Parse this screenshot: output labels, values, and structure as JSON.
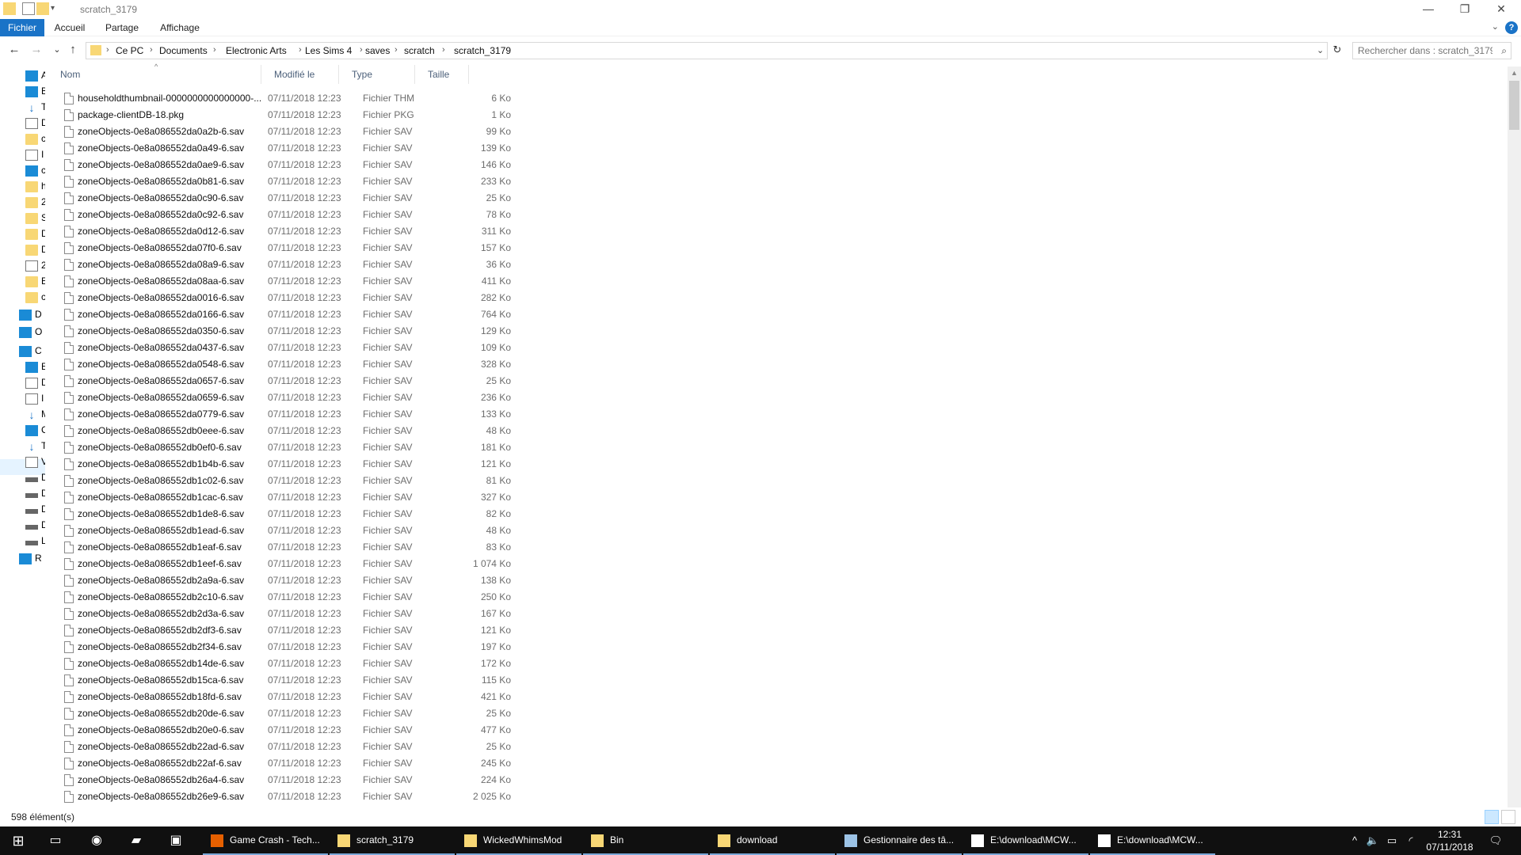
{
  "window": {
    "title": "scratch_3179",
    "minimize": "—",
    "maximize": "❐",
    "close": "✕"
  },
  "ribbon": {
    "tabs": [
      "Fichier",
      "Accueil",
      "Partage",
      "Affichage"
    ],
    "help": "?",
    "chevron": "⌄"
  },
  "nav": {
    "back": "←",
    "forward": "→",
    "recent": "⌄",
    "up": "↑",
    "refresh": "↻",
    "history": "⌄",
    "breadcrumb": [
      "Ce PC",
      "Documents",
      "Electronic Arts",
      "Les Sims 4",
      "saves",
      "scratch",
      "scratch_3179"
    ],
    "separator": "›"
  },
  "search": {
    "placeholder": "Rechercher dans : scratch_3179"
  },
  "sidebar": {
    "items": [
      "Ac",
      "B",
      "T",
      "D",
      "c",
      "I",
      "c",
      "h",
      "2",
      "S",
      "D",
      "D",
      "2",
      "E",
      "c",
      "Dr",
      "Or",
      "Ce",
      "E",
      "D",
      "I",
      "M",
      "C",
      "T",
      "V",
      "D",
      "D",
      "D",
      "D",
      "L",
      "Ré"
    ]
  },
  "columns": {
    "name": "Nom",
    "modified": "Modifié le",
    "type": "Type",
    "size": "Taille",
    "sort": "^"
  },
  "files": [
    {
      "name": "householdthumbnail-0000000000000000-...",
      "date": "07/11/2018 12:23",
      "type": "Fichier THM",
      "size": "6 Ko"
    },
    {
      "name": "package-clientDB-18.pkg",
      "date": "07/11/2018 12:23",
      "type": "Fichier PKG",
      "size": "1 Ko"
    },
    {
      "name": "zoneObjects-0e8a086552da0a2b-6.sav",
      "date": "07/11/2018 12:23",
      "type": "Fichier SAV",
      "size": "99 Ko"
    },
    {
      "name": "zoneObjects-0e8a086552da0a49-6.sav",
      "date": "07/11/2018 12:23",
      "type": "Fichier SAV",
      "size": "139 Ko"
    },
    {
      "name": "zoneObjects-0e8a086552da0ae9-6.sav",
      "date": "07/11/2018 12:23",
      "type": "Fichier SAV",
      "size": "146 Ko"
    },
    {
      "name": "zoneObjects-0e8a086552da0b81-6.sav",
      "date": "07/11/2018 12:23",
      "type": "Fichier SAV",
      "size": "233 Ko"
    },
    {
      "name": "zoneObjects-0e8a086552da0c90-6.sav",
      "date": "07/11/2018 12:23",
      "type": "Fichier SAV",
      "size": "25 Ko"
    },
    {
      "name": "zoneObjects-0e8a086552da0c92-6.sav",
      "date": "07/11/2018 12:23",
      "type": "Fichier SAV",
      "size": "78 Ko"
    },
    {
      "name": "zoneObjects-0e8a086552da0d12-6.sav",
      "date": "07/11/2018 12:23",
      "type": "Fichier SAV",
      "size": "311 Ko"
    },
    {
      "name": "zoneObjects-0e8a086552da07f0-6.sav",
      "date": "07/11/2018 12:23",
      "type": "Fichier SAV",
      "size": "157 Ko"
    },
    {
      "name": "zoneObjects-0e8a086552da08a9-6.sav",
      "date": "07/11/2018 12:23",
      "type": "Fichier SAV",
      "size": "36 Ko"
    },
    {
      "name": "zoneObjects-0e8a086552da08aa-6.sav",
      "date": "07/11/2018 12:23",
      "type": "Fichier SAV",
      "size": "411 Ko"
    },
    {
      "name": "zoneObjects-0e8a086552da0016-6.sav",
      "date": "07/11/2018 12:23",
      "type": "Fichier SAV",
      "size": "282 Ko"
    },
    {
      "name": "zoneObjects-0e8a086552da0166-6.sav",
      "date": "07/11/2018 12:23",
      "type": "Fichier SAV",
      "size": "764 Ko"
    },
    {
      "name": "zoneObjects-0e8a086552da0350-6.sav",
      "date": "07/11/2018 12:23",
      "type": "Fichier SAV",
      "size": "129 Ko"
    },
    {
      "name": "zoneObjects-0e8a086552da0437-6.sav",
      "date": "07/11/2018 12:23",
      "type": "Fichier SAV",
      "size": "109 Ko"
    },
    {
      "name": "zoneObjects-0e8a086552da0548-6.sav",
      "date": "07/11/2018 12:23",
      "type": "Fichier SAV",
      "size": "328 Ko"
    },
    {
      "name": "zoneObjects-0e8a086552da0657-6.sav",
      "date": "07/11/2018 12:23",
      "type": "Fichier SAV",
      "size": "25 Ko"
    },
    {
      "name": "zoneObjects-0e8a086552da0659-6.sav",
      "date": "07/11/2018 12:23",
      "type": "Fichier SAV",
      "size": "236 Ko"
    },
    {
      "name": "zoneObjects-0e8a086552da0779-6.sav",
      "date": "07/11/2018 12:23",
      "type": "Fichier SAV",
      "size": "133 Ko"
    },
    {
      "name": "zoneObjects-0e8a086552db0eee-6.sav",
      "date": "07/11/2018 12:23",
      "type": "Fichier SAV",
      "size": "48 Ko"
    },
    {
      "name": "zoneObjects-0e8a086552db0ef0-6.sav",
      "date": "07/11/2018 12:23",
      "type": "Fichier SAV",
      "size": "181 Ko"
    },
    {
      "name": "zoneObjects-0e8a086552db1b4b-6.sav",
      "date": "07/11/2018 12:23",
      "type": "Fichier SAV",
      "size": "121 Ko"
    },
    {
      "name": "zoneObjects-0e8a086552db1c02-6.sav",
      "date": "07/11/2018 12:23",
      "type": "Fichier SAV",
      "size": "81 Ko"
    },
    {
      "name": "zoneObjects-0e8a086552db1cac-6.sav",
      "date": "07/11/2018 12:23",
      "type": "Fichier SAV",
      "size": "327 Ko"
    },
    {
      "name": "zoneObjects-0e8a086552db1de8-6.sav",
      "date": "07/11/2018 12:23",
      "type": "Fichier SAV",
      "size": "82 Ko"
    },
    {
      "name": "zoneObjects-0e8a086552db1ead-6.sav",
      "date": "07/11/2018 12:23",
      "type": "Fichier SAV",
      "size": "48 Ko"
    },
    {
      "name": "zoneObjects-0e8a086552db1eaf-6.sav",
      "date": "07/11/2018 12:23",
      "type": "Fichier SAV",
      "size": "83 Ko"
    },
    {
      "name": "zoneObjects-0e8a086552db1eef-6.sav",
      "date": "07/11/2018 12:23",
      "type": "Fichier SAV",
      "size": "1 074 Ko"
    },
    {
      "name": "zoneObjects-0e8a086552db2a9a-6.sav",
      "date": "07/11/2018 12:23",
      "type": "Fichier SAV",
      "size": "138 Ko"
    },
    {
      "name": "zoneObjects-0e8a086552db2c10-6.sav",
      "date": "07/11/2018 12:23",
      "type": "Fichier SAV",
      "size": "250 Ko"
    },
    {
      "name": "zoneObjects-0e8a086552db2d3a-6.sav",
      "date": "07/11/2018 12:23",
      "type": "Fichier SAV",
      "size": "167 Ko"
    },
    {
      "name": "zoneObjects-0e8a086552db2df3-6.sav",
      "date": "07/11/2018 12:23",
      "type": "Fichier SAV",
      "size": "121 Ko"
    },
    {
      "name": "zoneObjects-0e8a086552db2f34-6.sav",
      "date": "07/11/2018 12:23",
      "type": "Fichier SAV",
      "size": "197 Ko"
    },
    {
      "name": "zoneObjects-0e8a086552db14de-6.sav",
      "date": "07/11/2018 12:23",
      "type": "Fichier SAV",
      "size": "172 Ko"
    },
    {
      "name": "zoneObjects-0e8a086552db15ca-6.sav",
      "date": "07/11/2018 12:23",
      "type": "Fichier SAV",
      "size": "115 Ko"
    },
    {
      "name": "zoneObjects-0e8a086552db18fd-6.sav",
      "date": "07/11/2018 12:23",
      "type": "Fichier SAV",
      "size": "421 Ko"
    },
    {
      "name": "zoneObjects-0e8a086552db20de-6.sav",
      "date": "07/11/2018 12:23",
      "type": "Fichier SAV",
      "size": "25 Ko"
    },
    {
      "name": "zoneObjects-0e8a086552db20e0-6.sav",
      "date": "07/11/2018 12:23",
      "type": "Fichier SAV",
      "size": "477 Ko"
    },
    {
      "name": "zoneObjects-0e8a086552db22ad-6.sav",
      "date": "07/11/2018 12:23",
      "type": "Fichier SAV",
      "size": "25 Ko"
    },
    {
      "name": "zoneObjects-0e8a086552db22af-6.sav",
      "date": "07/11/2018 12:23",
      "type": "Fichier SAV",
      "size": "245 Ko"
    },
    {
      "name": "zoneObjects-0e8a086552db26a4-6.sav",
      "date": "07/11/2018 12:23",
      "type": "Fichier SAV",
      "size": "224 Ko"
    },
    {
      "name": "zoneObjects-0e8a086552db26e9-6.sav",
      "date": "07/11/2018 12:23",
      "type": "Fichier SAV",
      "size": "2 025 Ko"
    }
  ],
  "status": {
    "count": "598 élément(s)"
  },
  "taskbar": {
    "start": "⊞",
    "taskview": "▭",
    "apps": [
      {
        "label": "Game Crash - Tech...",
        "color": "#e66000"
      },
      {
        "label": "scratch_3179",
        "color": "#f8d775"
      },
      {
        "label": "WickedWhimsMod",
        "color": "#f8d775"
      },
      {
        "label": "Bin",
        "color": "#f8d775"
      },
      {
        "label": "download",
        "color": "#f8d775"
      },
      {
        "label": "Gestionnaire des tâ...",
        "color": "#9cc3e6"
      },
      {
        "label": "E:\\download\\MCW...",
        "color": "#ffffff"
      },
      {
        "label": "E:\\download\\MCW...",
        "color": "#ffffff"
      }
    ],
    "time": "12:31",
    "date": "07/11/2018",
    "tray_chevron": "^",
    "volume": "🔈",
    "notification": "🗨"
  },
  "colors": {
    "accent": "#1a73c7",
    "taskbar": "#101010",
    "folder": "#f8d775"
  }
}
